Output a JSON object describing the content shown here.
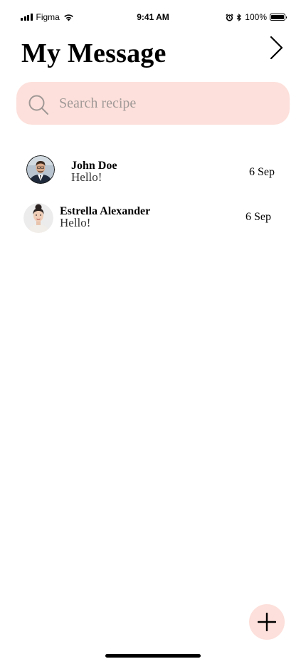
{
  "status_bar": {
    "carrier": "Figma",
    "time": "9:41 AM",
    "battery": "100%"
  },
  "header": {
    "title": "My Message",
    "next_icon": "chevron-right-icon"
  },
  "search": {
    "placeholder": "Search recipe",
    "icon": "search-icon"
  },
  "messages": [
    {
      "name": "John Doe",
      "preview": "Hello!",
      "date": "6 Sep",
      "avatar": "avatar-man-suit"
    },
    {
      "name": "Estrella Alexander",
      "preview": "Hello!",
      "date": "6 Sep",
      "avatar": "avatar-woman"
    }
  ],
  "fab": {
    "icon": "plus-icon"
  },
  "colors": {
    "accent_soft": "#fde0db",
    "placeholder": "#a19a98",
    "text": "#000000"
  }
}
